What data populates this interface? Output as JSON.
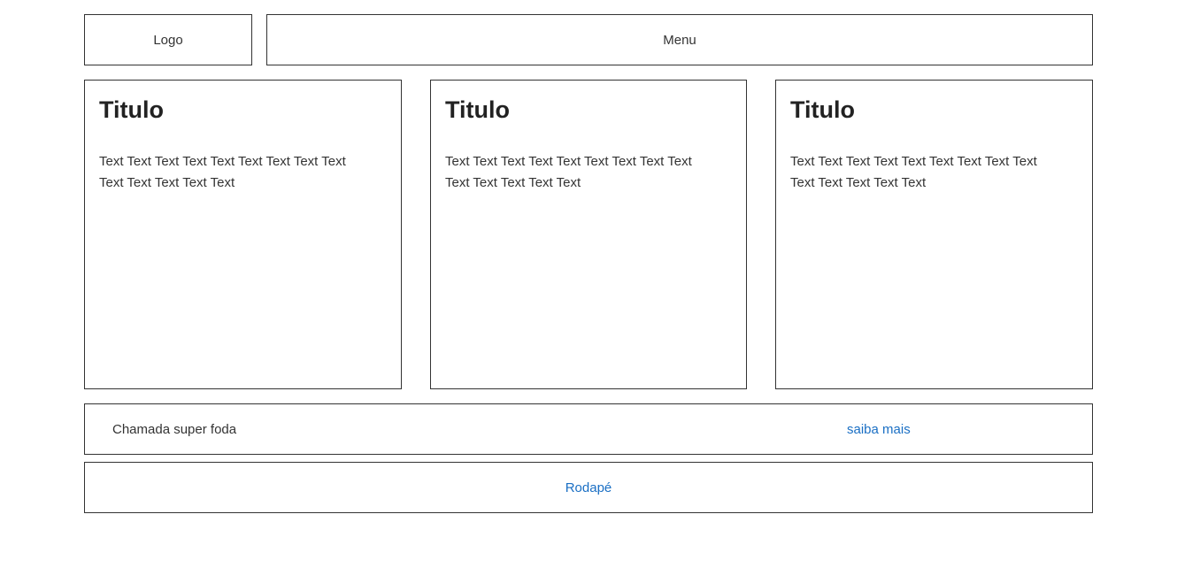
{
  "header": {
    "logo": "Logo",
    "menu": "Menu"
  },
  "cards": [
    {
      "title": "Titulo",
      "text": "Text Text Text Text Text Text Text Text Text Text Text Text Text Text"
    },
    {
      "title": "Titulo",
      "text": "Text Text Text Text Text Text Text Text Text Text Text Text Text Text"
    },
    {
      "title": "Titulo",
      "text": "Text Text Text Text Text Text Text Text Text Text Text Text Text Text"
    }
  ],
  "cta": {
    "text": "Chamada super foda",
    "link": "saiba mais"
  },
  "footer": {
    "link": "Rodapé"
  },
  "colors": {
    "border": "#333333",
    "link": "#1a6fc4",
    "text": "#333333",
    "background": "#ffffff"
  }
}
